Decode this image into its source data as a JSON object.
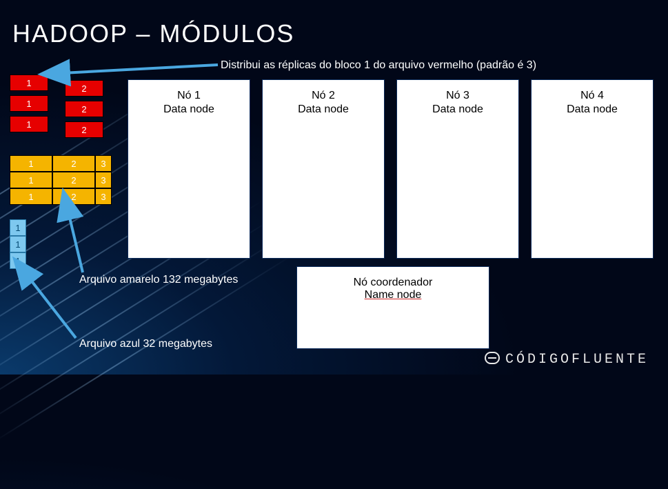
{
  "title": "HADOOP – MÓDULOS",
  "annotations": {
    "distribute": "Distribui as réplicas do bloco 1 do arquivo vermelho (padrão é 3)",
    "yellow_file": "Arquivo amarelo 132 megabytes",
    "blue_file": "Arquivo azul 32 megabytes"
  },
  "red_blocks": {
    "col1": [
      "1",
      "1",
      "1"
    ],
    "col2": [
      "2",
      "2",
      "2"
    ]
  },
  "yellow_blocks": {
    "rows": [
      [
        "1",
        "2",
        "3"
      ],
      [
        "1",
        "2",
        "3"
      ],
      [
        "1",
        "2",
        "3"
      ]
    ]
  },
  "blue_blocks": [
    "1",
    "1",
    "1"
  ],
  "nodes": [
    {
      "title": "Nó 1",
      "subtitle": "Data node"
    },
    {
      "title": "Nó 2",
      "subtitle": "Data node"
    },
    {
      "title": "Nó 3",
      "subtitle": "Data node"
    },
    {
      "title": "Nó 4",
      "subtitle": "Data node"
    }
  ],
  "coordinator": {
    "title": "Nó coordenador",
    "subtitle": "Name node"
  },
  "branding": "CÓDIGOFLUENTE"
}
